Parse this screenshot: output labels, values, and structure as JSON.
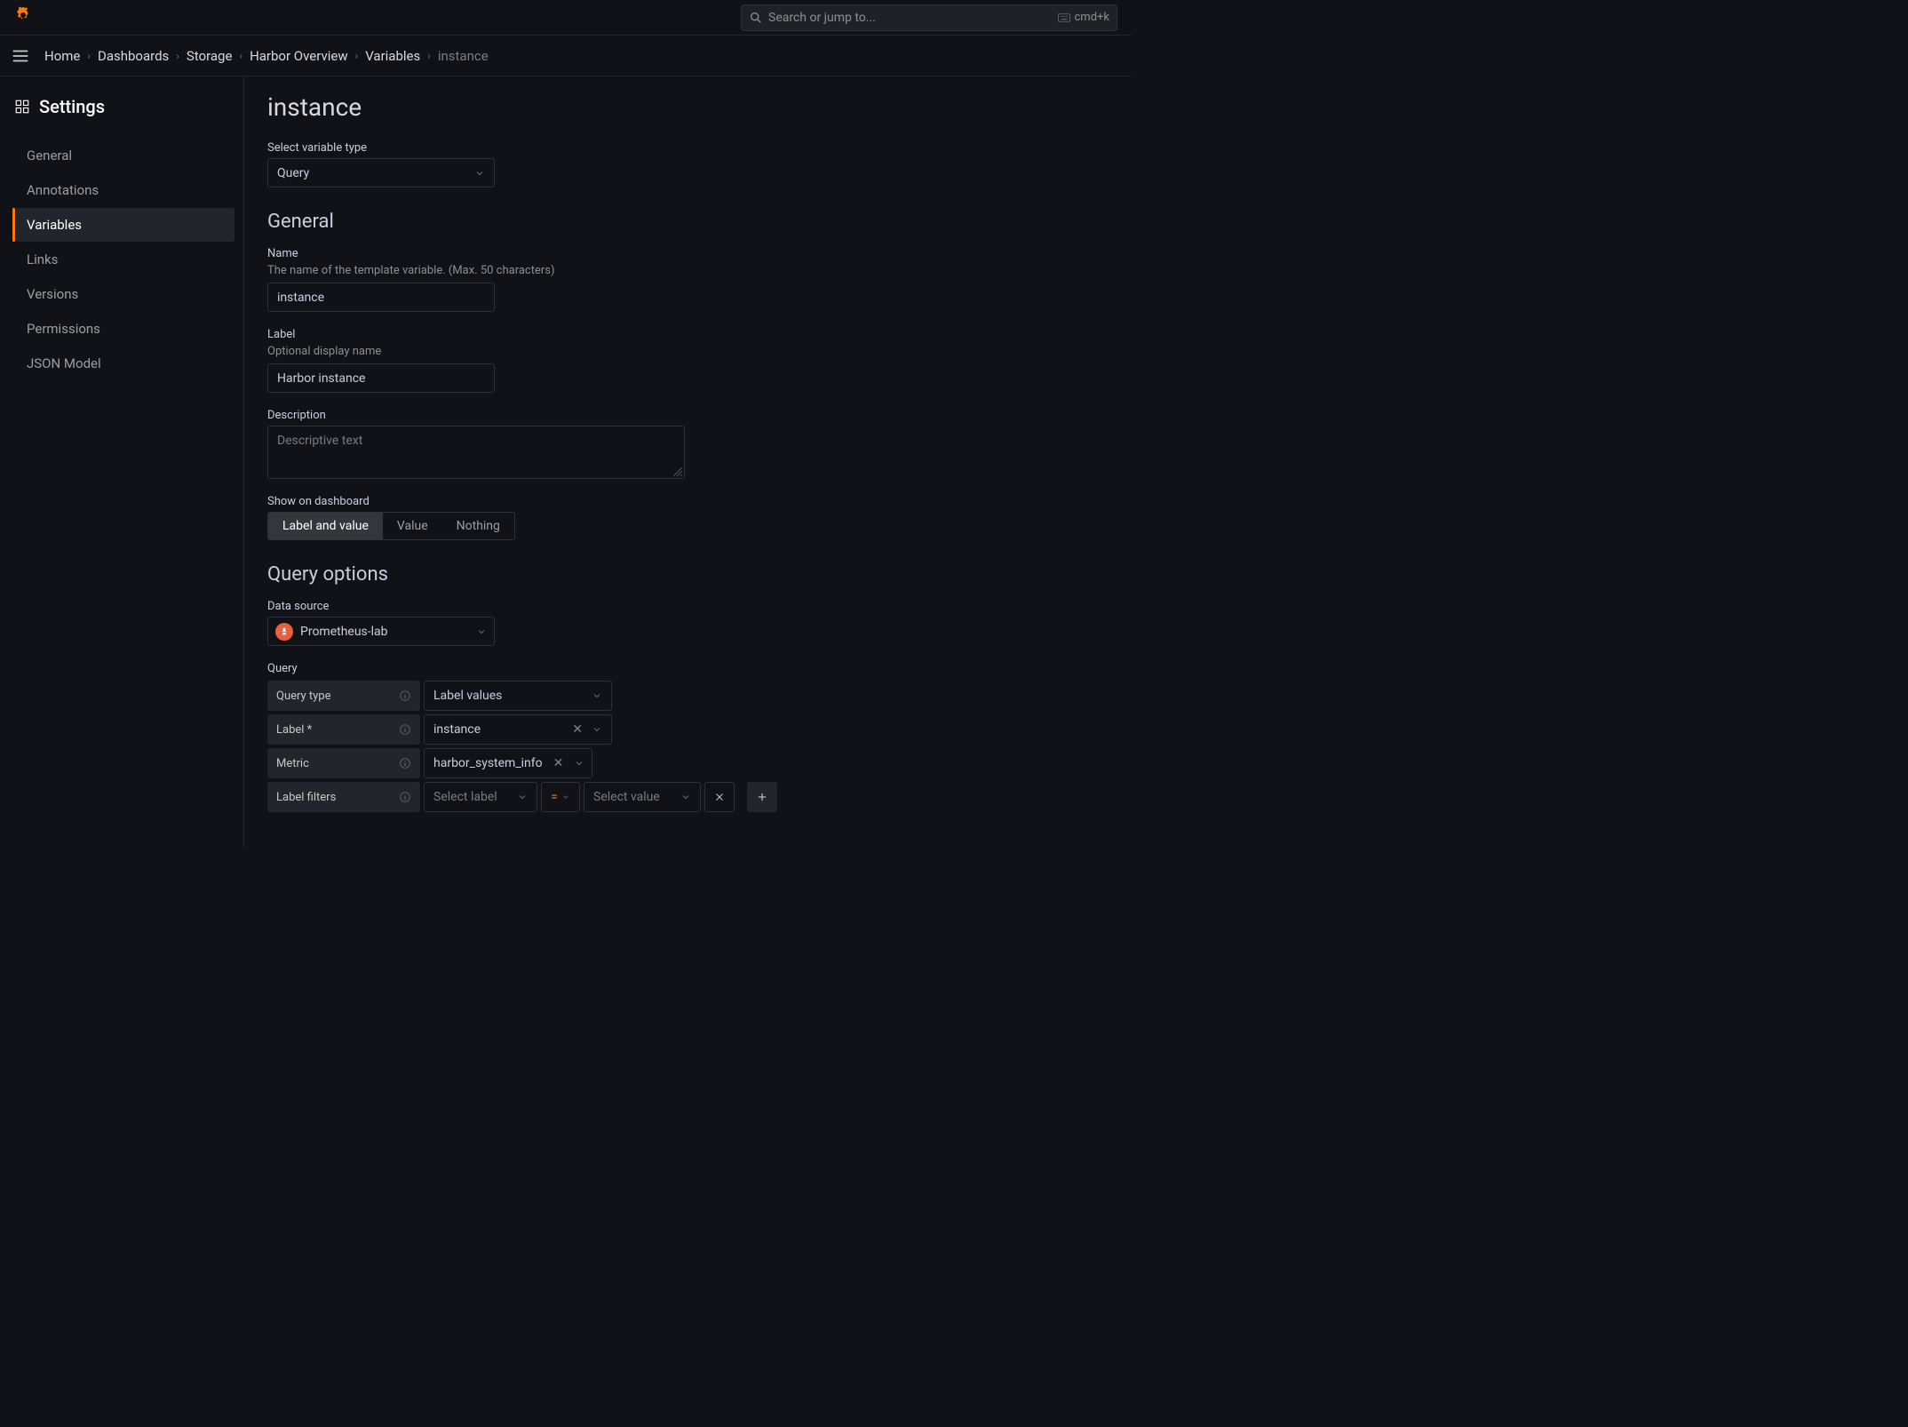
{
  "topbar": {
    "search_placeholder": "Search or jump to...",
    "shortcut": "cmd+k"
  },
  "breadcrumbs": [
    "Home",
    "Dashboards",
    "Storage",
    "Harbor Overview",
    "Variables",
    "instance"
  ],
  "sidebar": {
    "title": "Settings",
    "items": [
      "General",
      "Annotations",
      "Variables",
      "Links",
      "Versions",
      "Permissions",
      "JSON Model"
    ],
    "active_index": 2
  },
  "page": {
    "title": "instance",
    "variable_type": {
      "label": "Select variable type",
      "value": "Query"
    },
    "sections": {
      "general": {
        "heading": "General",
        "name": {
          "label": "Name",
          "help": "The name of the template variable. (Max. 50 characters)",
          "value": "instance"
        },
        "label_field": {
          "label": "Label",
          "help": "Optional display name",
          "value": "Harbor instance"
        },
        "description": {
          "label": "Description",
          "placeholder": "Descriptive text",
          "value": ""
        },
        "show_on_dashboard": {
          "label": "Show on dashboard",
          "options": [
            "Label and value",
            "Value",
            "Nothing"
          ],
          "selected": 0
        }
      },
      "query_options": {
        "heading": "Query options",
        "data_source": {
          "label": "Data source",
          "value": "Prometheus-lab"
        },
        "query": {
          "label": "Query"
        },
        "query_type": {
          "label": "Query type",
          "value": "Label values"
        },
        "label_select": {
          "label": "Label *",
          "value": "instance"
        },
        "metric": {
          "label": "Metric",
          "value": "harbor_system_info"
        },
        "label_filters": {
          "label": "Label filters",
          "label_placeholder": "Select label",
          "op": "=",
          "value_placeholder": "Select value"
        }
      }
    }
  }
}
